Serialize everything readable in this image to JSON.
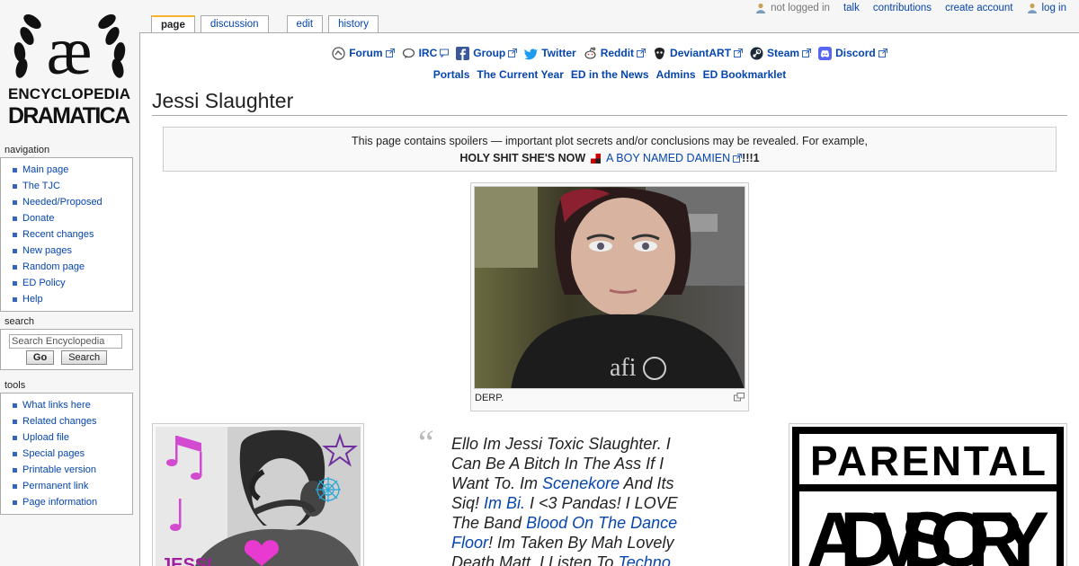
{
  "logo": {
    "glyph": "æ",
    "line1": "ENCYCLOPEDIA",
    "line2": "DRAMATICA"
  },
  "personal_tools": {
    "status": "not logged in",
    "talk": "talk",
    "contributions": "contributions",
    "create_account": "create account",
    "login": "log in"
  },
  "tabs": {
    "page": "page",
    "discussion": "discussion",
    "edit": "edit",
    "history": "history"
  },
  "sitenotice": {
    "social": [
      {
        "label": "Forum",
        "icon": "forum-icon"
      },
      {
        "label": "IRC",
        "icon": "irc-icon"
      },
      {
        "label": "Group",
        "icon": "facebook-icon"
      },
      {
        "label": "Twitter",
        "icon": "twitter-icon"
      },
      {
        "label": "Reddit",
        "icon": "reddit-icon"
      },
      {
        "label": "DeviantART",
        "icon": "deviantart-icon"
      },
      {
        "label": "Steam",
        "icon": "steam-icon"
      },
      {
        "label": "Discord",
        "icon": "discord-icon"
      }
    ],
    "links": [
      "Portals",
      "The Current Year",
      "ED in the News",
      "Admins",
      "ED Bookmarklet"
    ]
  },
  "page_title": "Jessi Slaughter",
  "spoiler": {
    "line1": "This page contains spoilers — important plot secrets and/or conclusions may be revealed. For example,",
    "bold": "HOLY SHIT SHE'S NOW",
    "link": "A BOY NAMED DAMIEN",
    "suffix": "!!!1"
  },
  "thumb_main": {
    "caption": "DERP."
  },
  "quote": {
    "p1": "Ello Im Jessi Toxic Slaughter. I Can Be A Bitch In The Ass If I Want To. Im ",
    "l1": "Scenekore",
    "p2": " And Its Siq! ",
    "l2": "Im Bi.",
    "p3": " I <3 Pandas! I LOVE The Band ",
    "l3": "Blood On The Dance Floor",
    "p4": "! Im Taken By Mah Lovely Death Matt. I Listen To ",
    "l4": "Techno"
  },
  "parental_advisory": {
    "line1": "PARENTAL",
    "line2": "ADVISORY"
  },
  "sidebar": {
    "navigation": {
      "title": "navigation",
      "items": [
        "Main page",
        "The TJC",
        "Needed/Proposed",
        "Donate",
        "Recent changes",
        "New pages",
        "Random page",
        "ED Policy",
        "Help"
      ]
    },
    "search": {
      "title": "search",
      "placeholder": "Search Encyclopedia",
      "go": "Go",
      "search": "Search"
    },
    "tools": {
      "title": "tools",
      "items": [
        "What links here",
        "Related changes",
        "Upload file",
        "Special pages",
        "Printable version",
        "Permanent link",
        "Page information"
      ]
    }
  },
  "colors": {
    "link": "#0645ad",
    "border": "#aaaaaa",
    "tab_accent": "#fab331"
  }
}
